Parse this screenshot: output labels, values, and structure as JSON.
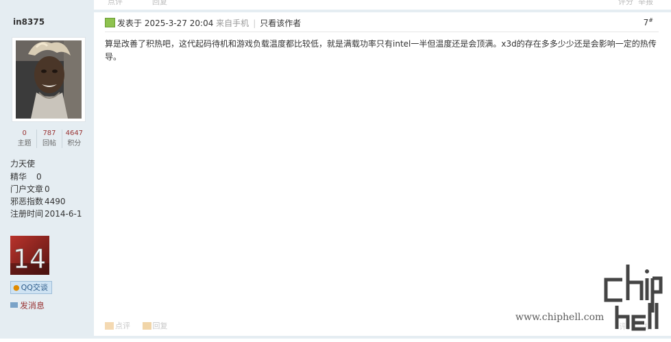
{
  "prev_post": {
    "comment_label": "点评",
    "reply_label": "回复",
    "rate_label": "评分",
    "report_label": "举报"
  },
  "author": {
    "username": "in8375",
    "stats": [
      {
        "value": "0",
        "label": "主题"
      },
      {
        "value": "787",
        "label": "回帖"
      },
      {
        "value": "4647",
        "label": "积分"
      }
    ],
    "group": "力天使",
    "details": [
      {
        "key": "精华",
        "value": "0"
      },
      {
        "key": "门户文章",
        "value": "0"
      },
      {
        "key": "邪恶指数",
        "value": "4490"
      },
      {
        "key": "注册时间",
        "value": "2014-6-1"
      }
    ],
    "medal_number": "14",
    "qq_label": "QQ交谈",
    "message_label": "发消息"
  },
  "post": {
    "posted_prefix": "发表于",
    "posted_time": "2025-3-27 20:04",
    "source": "来自手机",
    "only_author_label": "只看该作者",
    "floor": "7",
    "floor_sup": "#",
    "body": "算是改善了积热吧，这代起码待机和游戏负载温度都比较低，就是满载功率只有intel一半但温度还是会顶满。x3d的存在多多少少还是会影响一定的热传导。",
    "comment_label": "点评",
    "reply_label": "回复",
    "rate_label": "评分",
    "report_label": "举报"
  },
  "watermark": {
    "site": "www.chiphell.com",
    "logo_text": "chiphell"
  },
  "colors": {
    "sidebar_bg": "#E5EDF2",
    "accent_red": "#993333",
    "link_blue": "#2c5b8a"
  }
}
